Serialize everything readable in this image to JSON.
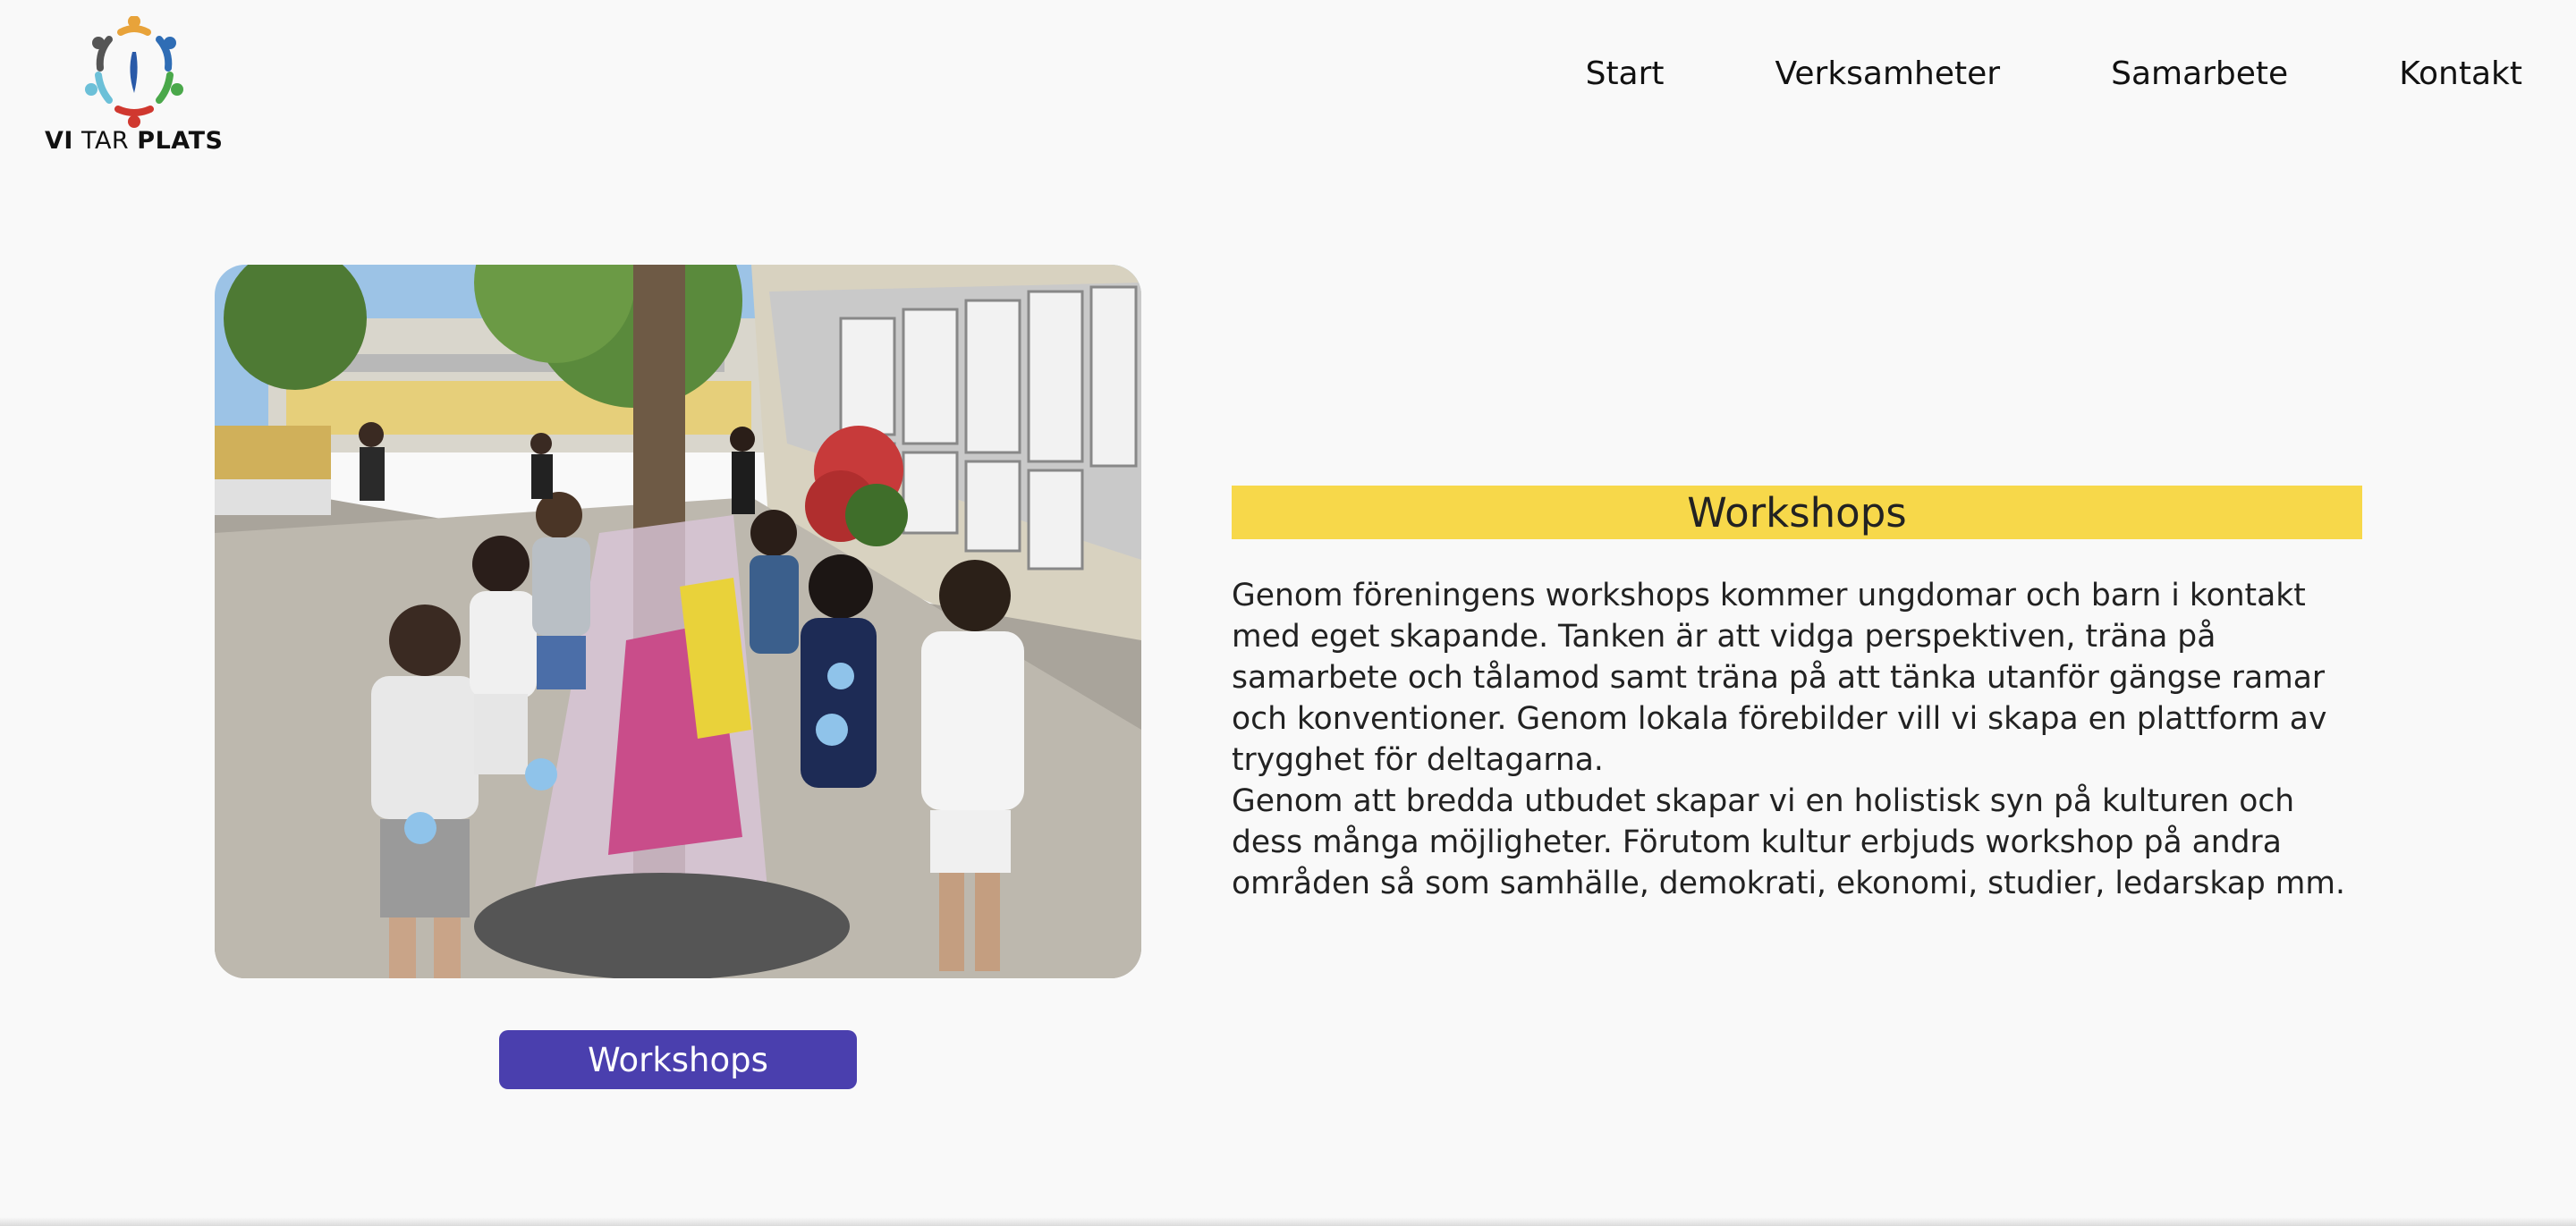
{
  "logo": {
    "text_part1": "VI",
    "text_part2": "TAR",
    "text_part3": "PLATS",
    "icon": "people-circle-logo"
  },
  "nav": {
    "items": [
      {
        "label": "Start"
      },
      {
        "label": "Verksamheter"
      },
      {
        "label": "Samarbete"
      },
      {
        "label": "Kontakt"
      }
    ]
  },
  "photo": {
    "description_icon": "workshop-photo"
  },
  "button": {
    "label": "Workshops"
  },
  "section": {
    "title": "Workshops",
    "paragraph1": "Genom föreningens workshops kommer ungdomar och barn i kontakt med eget skapande. Tanken är att vidga perspektiven, träna på samarbete och tålamod samt träna på att tänka utanför gängse ramar och konventioner. Genom lokala förebilder vill vi skapa en plattform av trygghet för deltagarna.",
    "paragraph2": "Genom att bredda utbudet skapar vi en holistisk syn på kulturen och dess många möjligheter. Förutom kultur erbjuds workshop på andra områden så som samhälle, demokrati, ekonomi, studier, ledarskap mm."
  },
  "colors": {
    "background": "#f9f9f9",
    "heading_bar": "#f7d84a",
    "button": "#4a3fae"
  }
}
